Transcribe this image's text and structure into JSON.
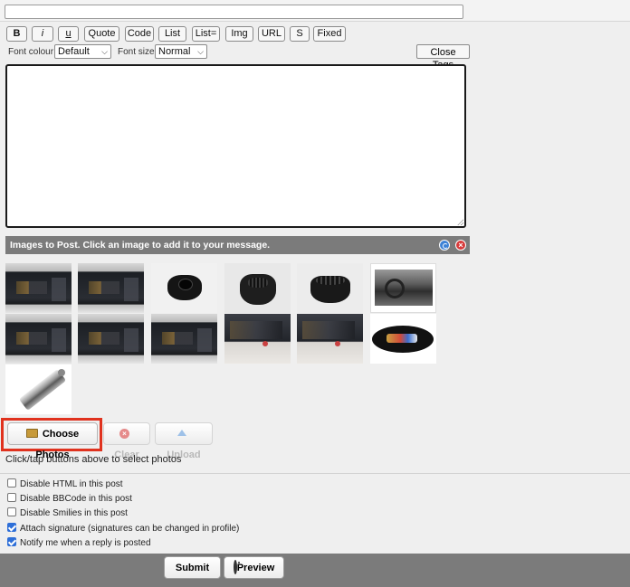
{
  "subject": {
    "value": ""
  },
  "toolbar": {
    "buttons": [
      "B",
      "i",
      "u",
      "Quote",
      "Code",
      "List",
      "List=",
      "Img",
      "URL",
      "S",
      "Fixed"
    ],
    "font_colour_label": "Font colour",
    "font_colour_value": "Default",
    "font_size_label": "Font size",
    "font_size_value": "Normal",
    "close_tags": "Close Tags"
  },
  "message": {
    "value": ""
  },
  "images_panel": {
    "header": "Images to Post. Click an image to add it to your message.",
    "refresh_icon": "refresh-icon",
    "remove_icon": "remove-icon",
    "thumbnails": [
      "dashboard-screen",
      "dashboard-screen",
      "black-mount",
      "black-mount",
      "black-mount",
      "car-dashboard",
      "dashboard-screen",
      "dashboard-screen",
      "dashboard-screen",
      "screen-in-car",
      "screen-in-car",
      "cable-loop",
      "metal-part"
    ]
  },
  "upload": {
    "choose": "Choose Photos",
    "clear": "Clear",
    "upload": "Upload",
    "hint": "Click/tap buttons above to select photos",
    "highlight_color": "#e0321e"
  },
  "options": [
    {
      "label": "Disable HTML in this post",
      "checked": false
    },
    {
      "label": "Disable BBCode in this post",
      "checked": false
    },
    {
      "label": "Disable Smilies in this post",
      "checked": false
    },
    {
      "label": "Attach signature (signatures can be changed in profile)",
      "checked": true
    },
    {
      "label": "Notify me when a reply is posted",
      "checked": true
    }
  ],
  "actions": {
    "submit": "Submit",
    "preview": "Preview"
  }
}
